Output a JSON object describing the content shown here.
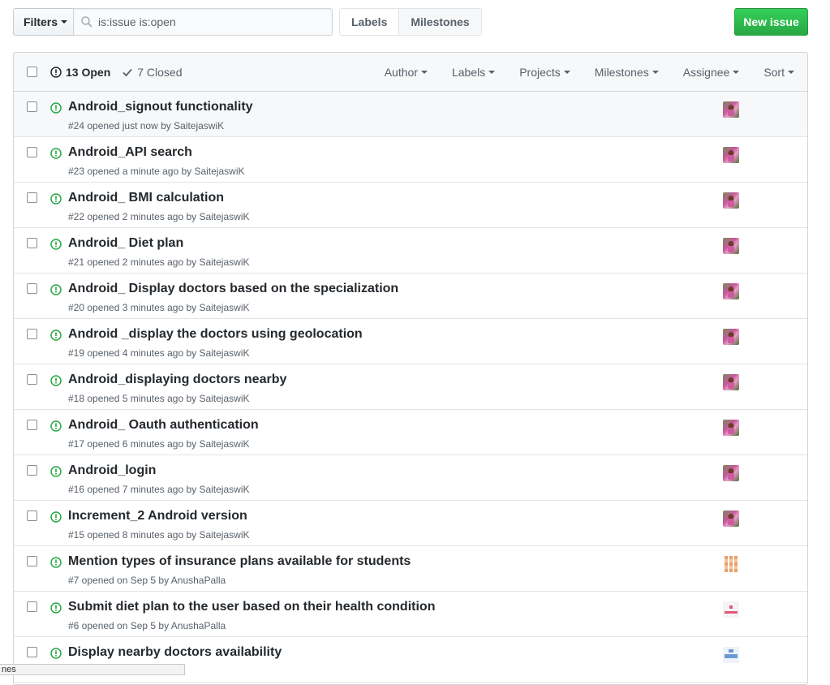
{
  "toolbar": {
    "filters_label": "Filters",
    "search_value": "is:issue is:open",
    "labels_label": "Labels",
    "milestones_label": "Milestones",
    "new_issue_label": "New issue"
  },
  "list_header": {
    "open_label": "13 Open",
    "closed_label": "7 Closed",
    "filters": [
      "Author",
      "Labels",
      "Projects",
      "Milestones",
      "Assignee",
      "Sort"
    ]
  },
  "issues": [
    {
      "title": "Android_signout functionality",
      "meta": "#24 opened just now by SaitejaswiK",
      "avatar": "photo"
    },
    {
      "title": "Android_API search",
      "meta": "#23 opened a minute ago by SaitejaswiK",
      "avatar": "photo"
    },
    {
      "title": "Android_ BMI calculation",
      "meta": "#22 opened 2 minutes ago by SaitejaswiK",
      "avatar": "photo"
    },
    {
      "title": "Android_ Diet plan",
      "meta": "#21 opened 2 minutes ago by SaitejaswiK",
      "avatar": "photo"
    },
    {
      "title": "Android_ Display doctors based on the specialization",
      "meta": "#20 opened 3 minutes ago by SaitejaswiK",
      "avatar": "photo"
    },
    {
      "title": "Android _display the doctors using geolocation",
      "meta": "#19 opened 4 minutes ago by SaitejaswiK",
      "avatar": "photo"
    },
    {
      "title": "Android_displaying doctors nearby",
      "meta": "#18 opened 5 minutes ago by SaitejaswiK",
      "avatar": "photo"
    },
    {
      "title": "Android_ Oauth authentication",
      "meta": "#17 opened 6 minutes ago by SaitejaswiK",
      "avatar": "photo"
    },
    {
      "title": "Android_login",
      "meta": "#16 opened 7 minutes ago by SaitejaswiK",
      "avatar": "photo"
    },
    {
      "title": "Increment_2 Android version",
      "meta": "#15 opened 8 minutes ago by SaitejaswiK",
      "avatar": "photo"
    },
    {
      "title": "Mention types of insurance plans available for students",
      "meta": "#7 opened on Sep 5 by AnushaPalla",
      "avatar": "ident-orange"
    },
    {
      "title": "Submit diet plan to the user based on their health condition",
      "meta": "#6 opened on Sep 5 by AnushaPalla",
      "avatar": "ident-pink"
    },
    {
      "title": "Display nearby doctors availability",
      "meta": "ushaPalla",
      "avatar": "ident-blue"
    }
  ],
  "status_bar": {
    "text": "nes"
  },
  "colors": {
    "open_green": "#28a745",
    "primary_button": "#2cbe4e"
  }
}
